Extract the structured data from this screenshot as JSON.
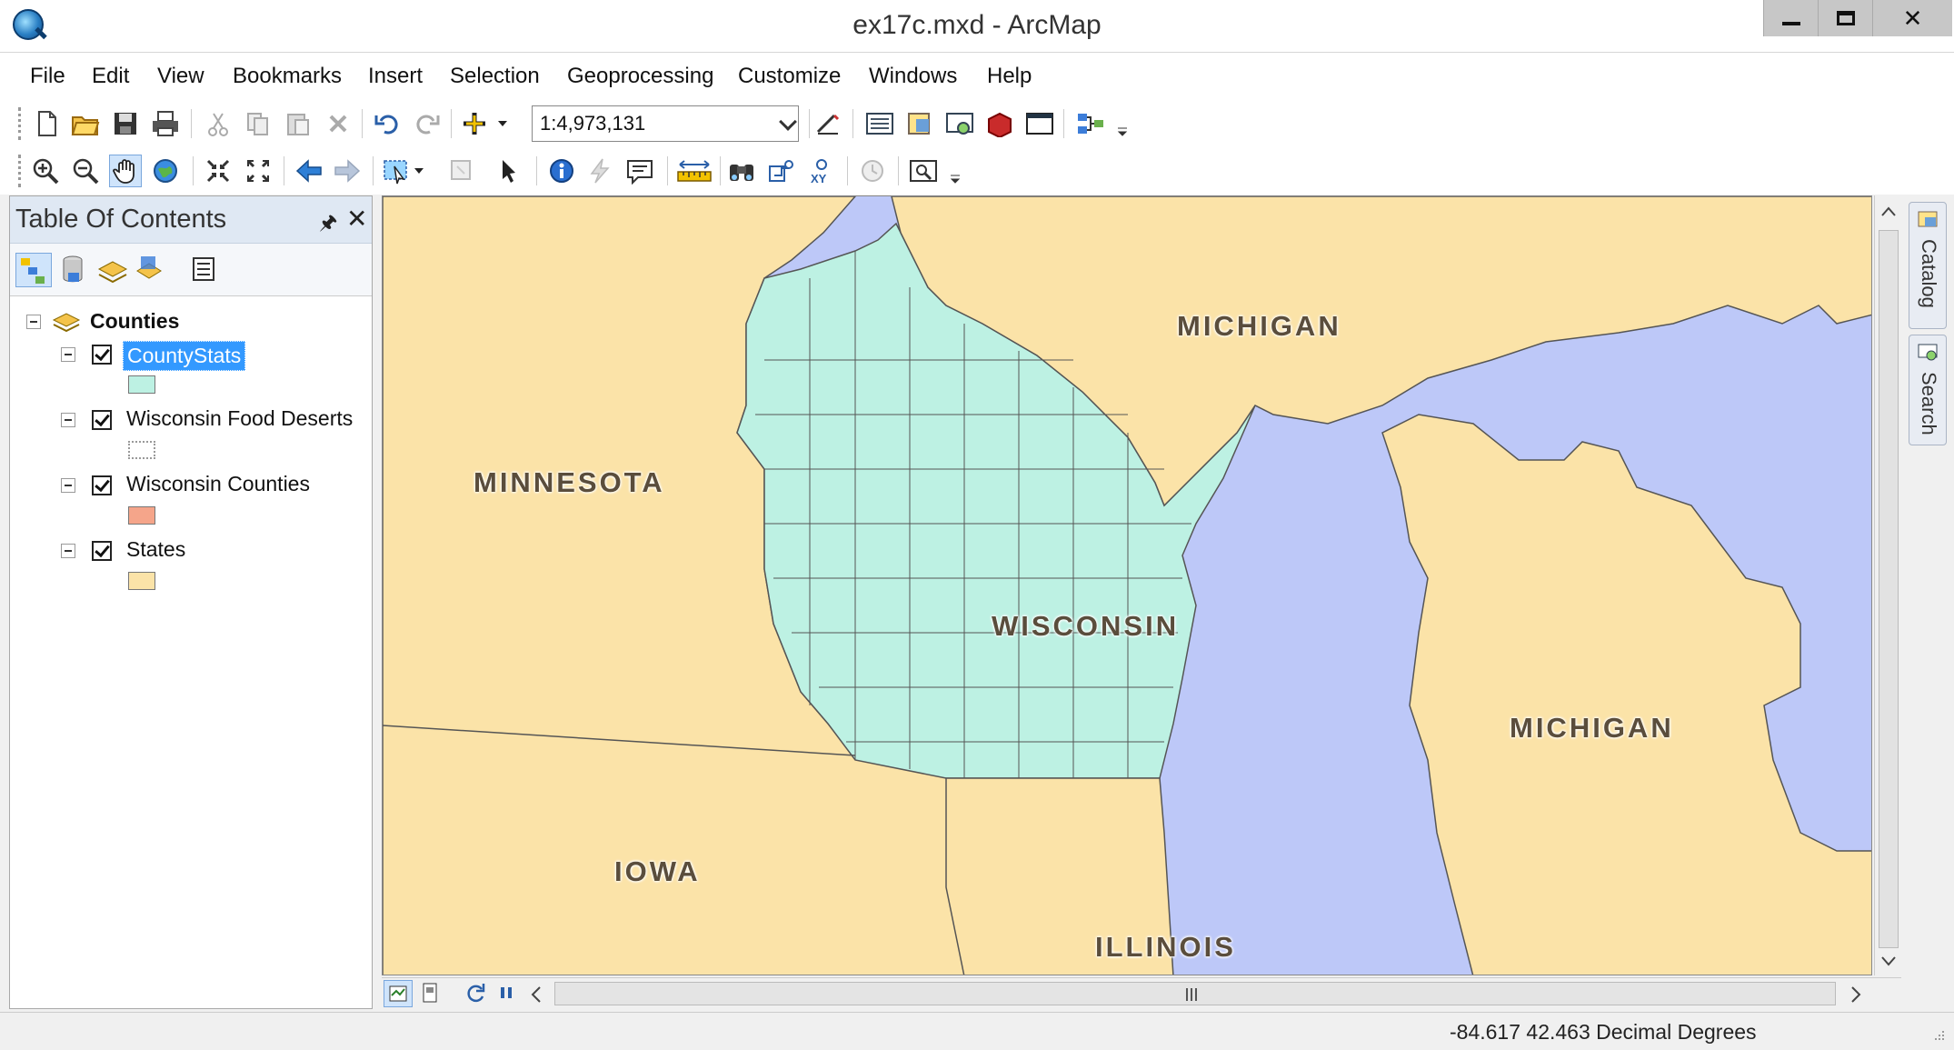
{
  "window": {
    "title": "ex17c.mxd - ArcMap",
    "min": "",
    "max": "",
    "close": "✕"
  },
  "menu": [
    "File",
    "Edit",
    "View",
    "Bookmarks",
    "Insert",
    "Selection",
    "Geoprocessing",
    "Customize",
    "Windows",
    "Help"
  ],
  "toolbar": {
    "scale": "1:4,973,131",
    "standard_icons": [
      "new-document-icon",
      "open-folder-icon",
      "save-icon",
      "print-icon",
      "cut-icon",
      "copy-icon",
      "paste-icon",
      "delete-icon",
      "undo-icon",
      "redo-icon",
      "add-data-icon",
      "editor-icon",
      "table-of-contents-icon",
      "catalog-icon",
      "search-window-icon",
      "arctoolbox-icon",
      "python-icon",
      "model-builder-icon"
    ],
    "tools_icons": [
      "zoom-in-icon",
      "zoom-out-icon",
      "pan-icon",
      "full-extent-icon",
      "fixed-zoom-in-icon",
      "fixed-zoom-out-icon",
      "back-extent-icon",
      "forward-extent-icon",
      "select-features-icon",
      "clear-selection-icon",
      "select-elements-icon",
      "identify-icon",
      "hyperlink-icon",
      "html-popup-icon",
      "measure-icon",
      "find-icon",
      "find-route-icon",
      "go-to-xy-icon",
      "time-slider-icon",
      "magnifier-window-icon"
    ]
  },
  "toc": {
    "title": "Table Of Contents",
    "pin": "🖈",
    "close": "✕",
    "frame": "Counties",
    "layers": [
      {
        "label": "CountyStats",
        "selected": true,
        "checked": true,
        "swatch": "#bdf1e3"
      },
      {
        "label": "Wisconsin Food Deserts",
        "selected": false,
        "checked": true,
        "swatch": "dotted"
      },
      {
        "label": "Wisconsin Counties",
        "selected": false,
        "checked": true,
        "swatch": "#f5a58a"
      },
      {
        "label": "States",
        "selected": false,
        "checked": true,
        "swatch": "#fbe3a8"
      }
    ]
  },
  "map": {
    "labels": [
      "MICHIGAN",
      "MINNESOTA",
      "WISCONSIN",
      "MICHIGAN",
      "IOWA",
      "ILLINOIS"
    ],
    "colors": {
      "water": "#bdc8f8",
      "state": "#fbe3a8",
      "county": "#bdf1e3",
      "outline": "#555555"
    }
  },
  "side_tabs": [
    "Catalog",
    "Search"
  ],
  "status": {
    "coords": "-84.617  42.463 Decimal Degrees"
  }
}
